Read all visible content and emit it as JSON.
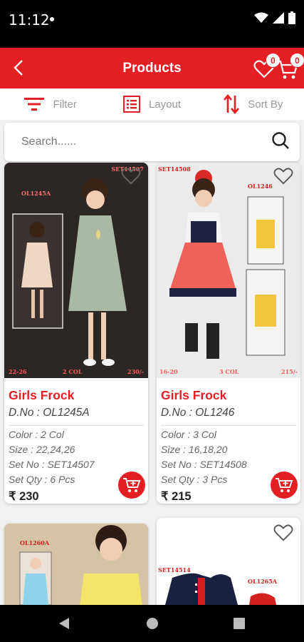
{
  "status_bar": {
    "time": "11:12"
  },
  "header": {
    "title": "Products",
    "wishlist_count": "0",
    "cart_count": "0"
  },
  "toolbar": {
    "filter_label": "Filter",
    "layout_label": "Layout",
    "sort_label": "Sort By"
  },
  "search": {
    "placeholder": "Search......"
  },
  "colors": {
    "brand": "#e31e24",
    "muted": "#9a9a9a"
  },
  "products": [
    {
      "name": "Girls Frock",
      "dno": "D.No : OL1245A",
      "color": "Color : 2 Col",
      "size": "Size : 22,24,26",
      "set_no": "Set No : SET14507",
      "set_qty": "Set Qty : 6 Pcs",
      "price": "₹ 230",
      "image_text": {
        "code": "OL1245A",
        "set": "SET14507",
        "range": "22-26",
        "cols": "2 COL",
        "price": "230/-"
      }
    },
    {
      "name": "Girls Frock",
      "dno": "D.No : OL1246",
      "color": "Color : 3 Col",
      "size": "Size : 16,18,20",
      "set_no": "Set No : SET14508",
      "set_qty": "Set Qty : 3 Pcs",
      "price": "₹ 215",
      "image_text": {
        "code": "OL1246",
        "set": "SET14508",
        "range": "16-20",
        "cols": "3 COL",
        "price": "215/-"
      }
    },
    {
      "image_text": {
        "code": "OL1260A"
      }
    },
    {
      "image_text": {
        "code": "OL1265A",
        "set": "SET14514"
      }
    }
  ]
}
